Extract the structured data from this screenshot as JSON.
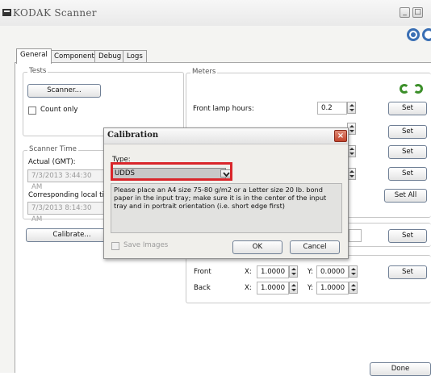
{
  "window": {
    "title": "KODAK  Scanner",
    "buttons": [
      "_",
      "□"
    ]
  },
  "tabs": [
    "General",
    "Component",
    "Debug",
    "Logs"
  ],
  "tests": {
    "legend": "Tests",
    "scanner_button": "Scanner...",
    "count_only_label": "Count only"
  },
  "scanner_time": {
    "legend": "Scanner Time",
    "actual_label": "Actual (GMT):",
    "actual_value": "7/3/2013 3:44:30 AM",
    "local_label": "Corresponding local tim",
    "local_value": "7/3/2013 8:14:30 AM"
  },
  "calibrate_button": "Calibrate...",
  "meters": {
    "legend": "Meters",
    "front_lamp_label": "Front lamp hours:",
    "front_lamp_value": "0.2",
    "set_label": "Set",
    "set_all_label": "Set All"
  },
  "position": {
    "front_label": "Front",
    "back_label": "Back",
    "x_label": "X:",
    "y_label": "Y:",
    "front_x": "1.0000",
    "front_y": "0.0000",
    "back_x": "1.0000",
    "back_y": "1.0000"
  },
  "dialog": {
    "title": "Calibration",
    "close_glyph": "×",
    "type_label": "Type:",
    "type_value": "UDDS",
    "instructions": "Please place an A4 size 75-80 g/m2 or a Letter size 20 lb. bond paper in the input tray; make sure it is in the center of the input tray and in portrait orientation (i.e. short edge first)",
    "save_images_label": "Save Images",
    "ok_label": "OK",
    "cancel_label": "Cancel"
  },
  "done_label": "Done",
  "colors": {
    "accent_red": "#d9262b",
    "refresh_green": "#3c8f2a"
  }
}
